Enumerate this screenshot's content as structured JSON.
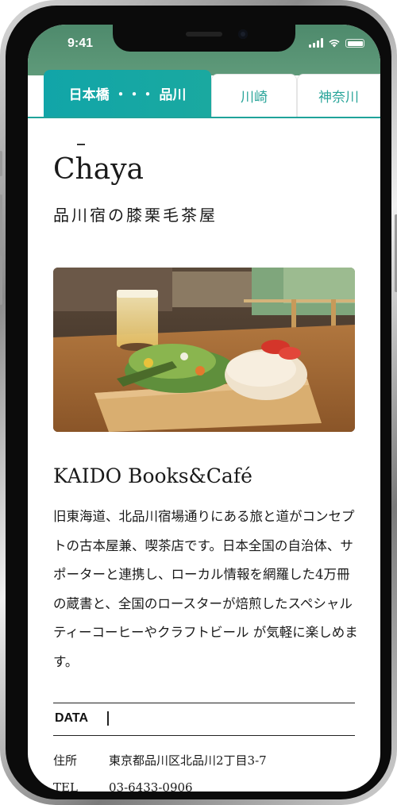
{
  "status_bar": {
    "time": "9:41"
  },
  "tabs": [
    {
      "label": "日本橋 ・・・ 品川",
      "active": true
    },
    {
      "label": "川崎",
      "active": false
    },
    {
      "label": "神奈川",
      "active": false
    }
  ],
  "article": {
    "title": "Chaya",
    "subtitle": "品川宿の膝栗毛茶屋",
    "shop_name": "KAIDO Books&Café",
    "description": "旧東海道、北品川宿場通りにある旅と道がコンセプトの古本屋兼、喫茶店です。日本全国の自治体、サポーターと連携し、ローカル情報を網羅した4万冊の蔵書と、全国のロースターが焙煎したスペシャルティーコーヒーやクラフトビール が気軽に楽しめます。"
  },
  "data_section": {
    "heading": "DATA",
    "rows": [
      {
        "label": "住所",
        "value": "東京都品川区北品川2丁目3-7"
      },
      {
        "label": "TEL",
        "value": "03-6433-0906"
      }
    ]
  },
  "colors": {
    "accent": "#1aa9a0",
    "statusbar": "#5a9575"
  }
}
